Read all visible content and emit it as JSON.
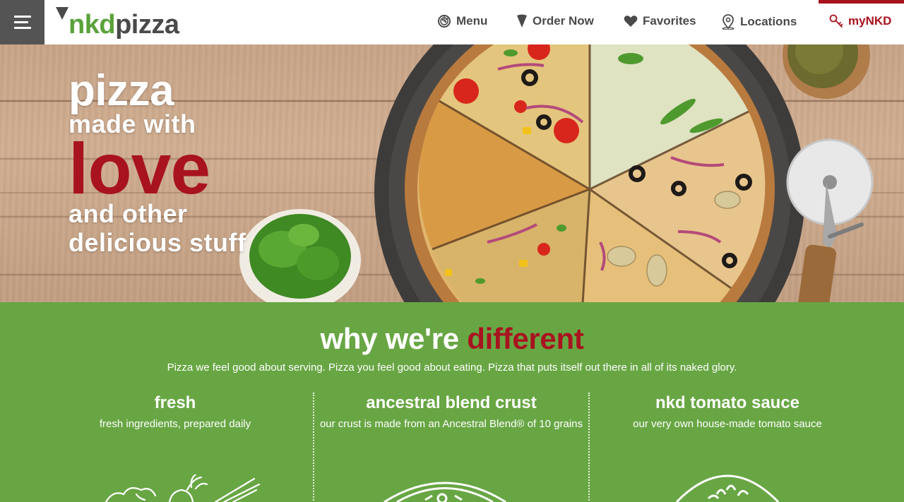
{
  "header": {
    "logo": {
      "part1": "nkd",
      "part2": "pizza"
    },
    "nav": [
      {
        "label": "Menu",
        "icon": "pizza-icon"
      },
      {
        "label": "Order Now",
        "icon": "slice-icon"
      },
      {
        "label": "Favorites",
        "icon": "heart-icon"
      },
      {
        "label": "Locations",
        "icon": "map-pin-icon"
      },
      {
        "label": "myNKD",
        "icon": "key-icon"
      }
    ],
    "accent_color": "#a8131f",
    "brand_green": "#5aa23a"
  },
  "hero": {
    "line1": "pizza",
    "line2": "made with",
    "line3": "love",
    "line4": "and other",
    "line5": "delicious stuff"
  },
  "different": {
    "title_part1": "why we're",
    "title_part2": "different",
    "subtitle": "Pizza we feel good about serving. Pizza you feel good about eating. Pizza that puts itself out there in all of its naked glory.",
    "columns": [
      {
        "title": "fresh",
        "text": "fresh ingredients, prepared daily",
        "icon": "vegetables-icon"
      },
      {
        "title": "ancestral blend crust",
        "text": "our crust is made from an Ancestral Blend® of 10 grains",
        "icon": "pizza-crust-icon"
      },
      {
        "title": "nkd tomato sauce",
        "text": "our very own house-made tomato sauce",
        "icon": "tomato-sauce-icon"
      }
    ],
    "background_color": "#68a644"
  }
}
